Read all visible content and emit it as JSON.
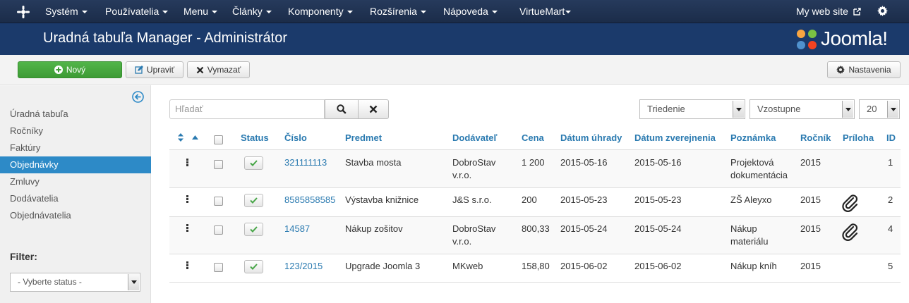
{
  "nav": {
    "items": [
      "Systém",
      "Používatelia",
      "Menu",
      "Články",
      "Komponenty",
      "Rozšírenia",
      "Nápoveda",
      "VirtueMart"
    ],
    "site_link": "My web site"
  },
  "header": {
    "title": "Uradná tabuľa Manager - Administrátor",
    "brand": "Joomla!"
  },
  "toolbar": {
    "new_label": "Nový",
    "edit_label": "Upraviť",
    "delete_label": "Vymazať",
    "settings_label": "Nastavenia"
  },
  "sidebar": {
    "items": [
      "Úradná tabuľa",
      "Ročníky",
      "Faktúry",
      "Objednávky",
      "Zmluvy",
      "Dodávatelia",
      "Objednávatelia"
    ],
    "active": "Objednávky",
    "filter_label": "Filter:",
    "status_select": "- Vyberte status -"
  },
  "search": {
    "placeholder": "Hľadať"
  },
  "sorting": {
    "order_by": "Triedenie",
    "direction": "Vzostupne",
    "limit": "20"
  },
  "table": {
    "headers": {
      "status": "Status",
      "cislo": "Číslo",
      "predmet": "Predmet",
      "dodavatel": "Dodávateľ",
      "cena": "Cena",
      "datum_uhrady": "Dátum úhrady",
      "datum_zverejnenia": "Dátum zverejnenia",
      "poznamka": "Poznámka",
      "rocnik": "Ročník",
      "priloha": "Príloha",
      "id": "ID"
    },
    "rows": [
      {
        "cislo": "321111113",
        "predmet": "Stavba mosta",
        "dodavatel": "DobroStav",
        "dodavatel2": "v.r.o.",
        "cena": "1 200",
        "datum_uhrady": "2015-05-16",
        "datum_zverejnenia": "2015-05-16",
        "poznamka": "Projektová",
        "poznamka2": "dokumentácia",
        "rocnik": "2015",
        "id": "1"
      },
      {
        "cislo": "8585858585",
        "predmet": "Výstavba knižnice",
        "dodavatel": "J&S s.r.o.",
        "dodavatel2": "",
        "cena": "200",
        "datum_uhrady": "2015-05-23",
        "datum_zverejnenia": "2015-05-23",
        "poznamka": "ZŠ Aleyxo",
        "poznamka2": "",
        "rocnik": "2015",
        "id": "2"
      },
      {
        "cislo": "14587",
        "predmet": "Nákup zošitov",
        "dodavatel": "DobroStav",
        "dodavatel2": "v.r.o.",
        "cena": "800,33",
        "datum_uhrady": "2015-05-24",
        "datum_zverejnenia": "2015-05-24",
        "poznamka": "Nákup",
        "poznamka2": "materiálu",
        "rocnik": "2015",
        "id": "4"
      },
      {
        "cislo": "123/2015",
        "predmet": "Upgrade Joomla 3",
        "dodavatel": "MKweb",
        "dodavatel2": "",
        "cena": "158,80",
        "datum_uhrady": "2015-06-02",
        "datum_zverejnenia": "2015-06-02",
        "poznamka": "Nákup kníh",
        "poznamka2": "",
        "rocnik": "2015",
        "id": "5"
      }
    ]
  }
}
